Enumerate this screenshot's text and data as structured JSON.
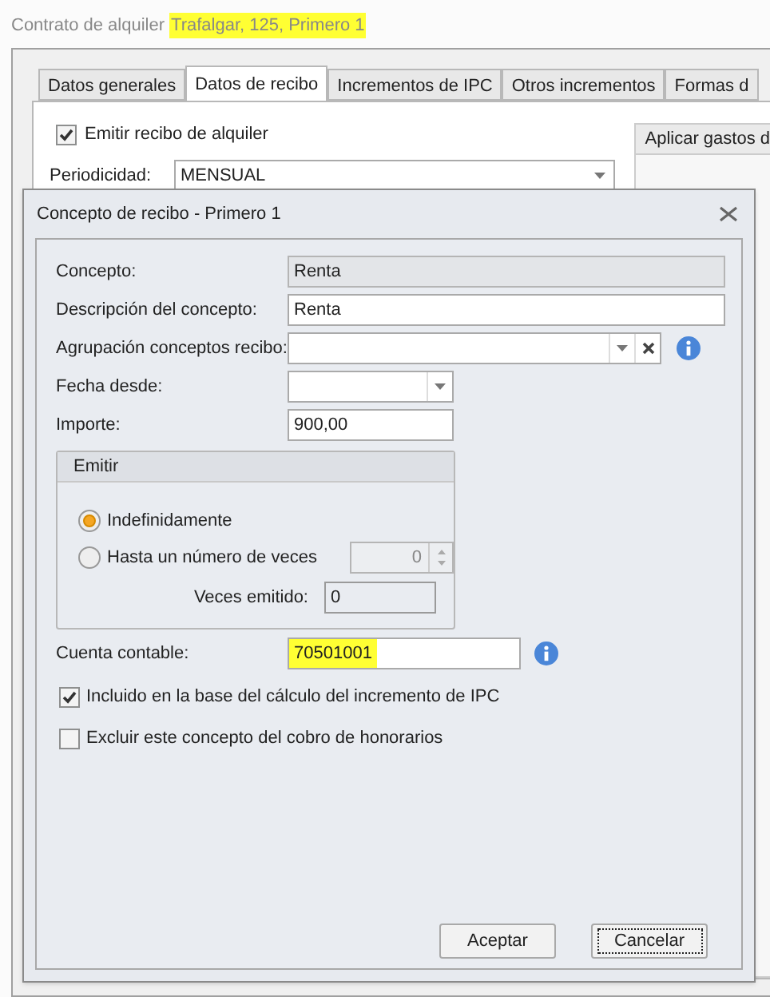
{
  "header": {
    "label": "Contrato de alquiler",
    "value": "Trafalgar, 125, Primero 1",
    "highlighted": true
  },
  "tabs": [
    {
      "label": "Datos generales",
      "selected": false
    },
    {
      "label": "Datos de recibo",
      "selected": true
    },
    {
      "label": "Incrementos de IPC",
      "selected": false
    },
    {
      "label": "Otros incrementos",
      "selected": false
    },
    {
      "label": "Formas d",
      "selected": false
    }
  ],
  "receipt": {
    "emit_checkbox": {
      "label": "Emitir recibo de alquiler",
      "checked": true
    },
    "periodicity": {
      "label": "Periodicidad:",
      "value": "MENSUAL"
    }
  },
  "side_panel": {
    "title": "Aplicar gastos d"
  },
  "dialog": {
    "title": "Concepto de recibo - Primero 1",
    "fields": [
      {
        "kind": "readonly",
        "label": "Concepto:",
        "value": "Renta"
      },
      {
        "kind": "text",
        "label": "Descripción del concepto:",
        "value": "Renta"
      },
      {
        "kind": "lookup",
        "label": "Agrupación conceptos recibo:"
      },
      {
        "kind": "date",
        "label": "Fecha desde:"
      },
      {
        "kind": "short",
        "label": "Importe:",
        "value": "900,00"
      }
    ],
    "emit_group": {
      "title": "Emitir",
      "options": [
        {
          "label": "Indefinidamente",
          "selected": true
        },
        {
          "label": "Hasta un número de veces",
          "selected": false
        }
      ],
      "times_value": "0",
      "emitted_label": "Veces emitido:",
      "emitted_value": "0"
    },
    "account": {
      "label": "Cuenta contable:",
      "value": "70501001",
      "highlighted": true
    },
    "checkboxes": [
      {
        "label": "Incluido en la base del cálculo del incremento de IPC",
        "checked": true
      },
      {
        "label": "Excluir este concepto del cobro de honorarios",
        "checked": false
      }
    ],
    "buttons": [
      {
        "label": "Aceptar",
        "focused": false
      },
      {
        "label": "Cancelar",
        "focused": true
      }
    ]
  }
}
